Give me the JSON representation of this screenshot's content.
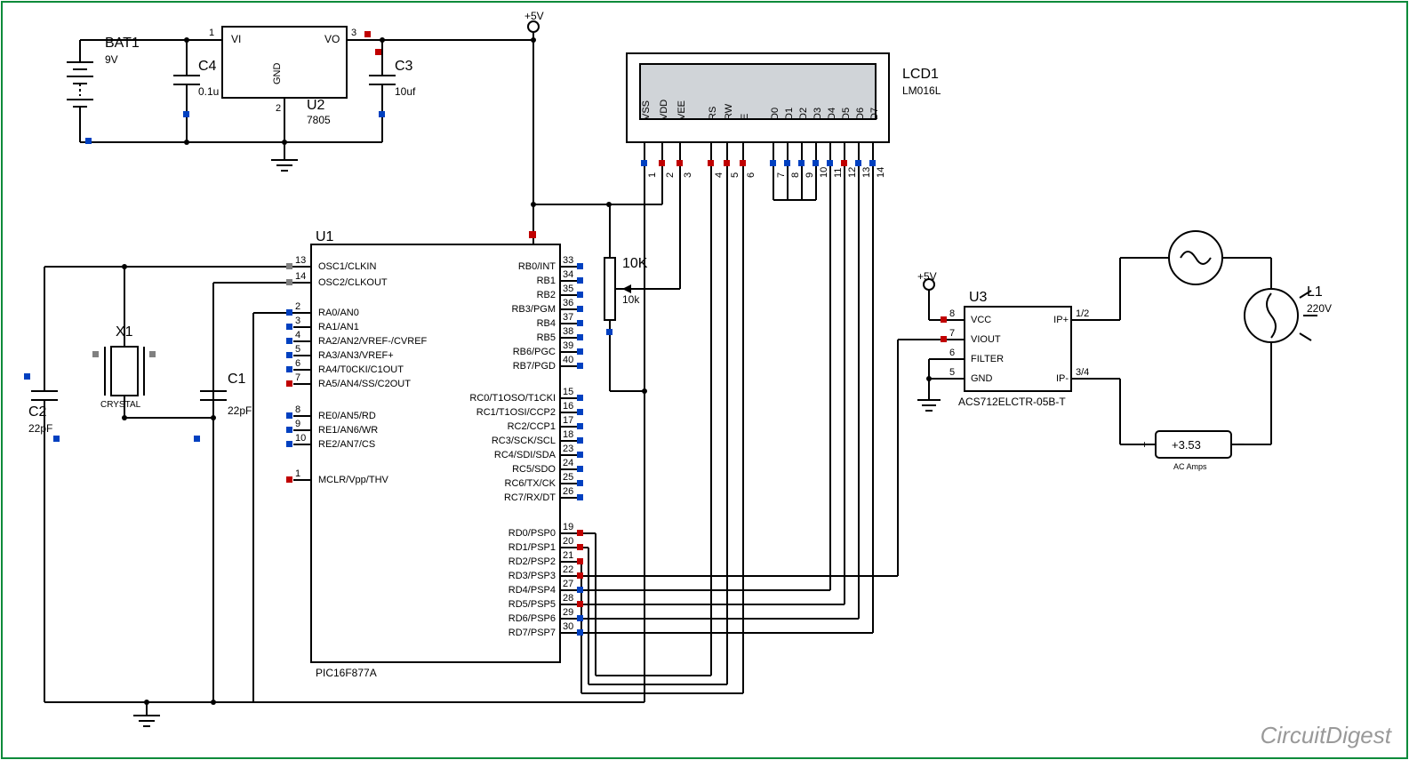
{
  "components": {
    "bat1": {
      "name": "BAT1",
      "value": "9V"
    },
    "c4": {
      "name": "C4",
      "value": "0.1u"
    },
    "u2": {
      "name": "U2",
      "value": "7805",
      "pins": {
        "vi": "VI",
        "vo": "VO",
        "gnd": "GND",
        "p1": "1",
        "p2": "2",
        "p3": "3"
      }
    },
    "c3": {
      "name": "C3",
      "value": "10uf"
    },
    "c2": {
      "name": "C2",
      "value": "22pF"
    },
    "c1": {
      "name": "C1",
      "value": "22pF"
    },
    "x1": {
      "name": "X1",
      "value": "CRYSTAL"
    },
    "u1": {
      "name": "U1",
      "value": "PIC16F877A"
    },
    "pot": {
      "name": "10K",
      "value": "10k"
    },
    "lcd1": {
      "name": "LCD1",
      "value": "LM016L"
    },
    "u3": {
      "name": "U3",
      "value": "ACS712ELCTR-05B-T"
    },
    "l1": {
      "name": "L1",
      "value": "220V"
    },
    "ammeter": {
      "reading": "+3.53",
      "unit": "AC Amps"
    }
  },
  "rails": {
    "five_v": "+5V"
  },
  "u1_pins_left": [
    {
      "num": "13",
      "name": "OSC1/CLKIN"
    },
    {
      "num": "14",
      "name": "OSC2/CLKOUT"
    },
    {
      "num": "2",
      "name": "RA0/AN0"
    },
    {
      "num": "3",
      "name": "RA1/AN1"
    },
    {
      "num": "4",
      "name": "RA2/AN2/VREF-/CVREF"
    },
    {
      "num": "5",
      "name": "RA3/AN3/VREF+"
    },
    {
      "num": "6",
      "name": "RA4/T0CKI/C1OUT"
    },
    {
      "num": "7",
      "name": "RA5/AN4/SS/C2OUT"
    },
    {
      "num": "8",
      "name": "RE0/AN5/RD"
    },
    {
      "num": "9",
      "name": "RE1/AN6/WR"
    },
    {
      "num": "10",
      "name": "RE2/AN7/CS"
    },
    {
      "num": "1",
      "name": "MCLR/Vpp/THV"
    }
  ],
  "u1_pins_right": [
    {
      "num": "33",
      "name": "RB0/INT"
    },
    {
      "num": "34",
      "name": "RB1"
    },
    {
      "num": "35",
      "name": "RB2"
    },
    {
      "num": "36",
      "name": "RB3/PGM"
    },
    {
      "num": "37",
      "name": "RB4"
    },
    {
      "num": "38",
      "name": "RB5"
    },
    {
      "num": "39",
      "name": "RB6/PGC"
    },
    {
      "num": "40",
      "name": "RB7/PGD"
    },
    {
      "num": "15",
      "name": "RC0/T1OSO/T1CKI"
    },
    {
      "num": "16",
      "name": "RC1/T1OSI/CCP2"
    },
    {
      "num": "17",
      "name": "RC2/CCP1"
    },
    {
      "num": "18",
      "name": "RC3/SCK/SCL"
    },
    {
      "num": "23",
      "name": "RC4/SDI/SDA"
    },
    {
      "num": "24",
      "name": "RC5/SDO"
    },
    {
      "num": "25",
      "name": "RC6/TX/CK"
    },
    {
      "num": "26",
      "name": "RC7/RX/DT"
    },
    {
      "num": "19",
      "name": "RD0/PSP0"
    },
    {
      "num": "20",
      "name": "RD1/PSP1"
    },
    {
      "num": "21",
      "name": "RD2/PSP2"
    },
    {
      "num": "22",
      "name": "RD3/PSP3"
    },
    {
      "num": "27",
      "name": "RD4/PSP4"
    },
    {
      "num": "28",
      "name": "RD5/PSP5"
    },
    {
      "num": "29",
      "name": "RD6/PSP6"
    },
    {
      "num": "30",
      "name": "RD7/PSP7"
    }
  ],
  "lcd_pins": [
    {
      "num": "1",
      "name": "VSS"
    },
    {
      "num": "2",
      "name": "VDD"
    },
    {
      "num": "3",
      "name": "VEE"
    },
    {
      "num": "4",
      "name": "RS"
    },
    {
      "num": "5",
      "name": "RW"
    },
    {
      "num": "6",
      "name": "E"
    },
    {
      "num": "7",
      "name": "D0"
    },
    {
      "num": "8",
      "name": "D1"
    },
    {
      "num": "9",
      "name": "D2"
    },
    {
      "num": "10",
      "name": "D3"
    },
    {
      "num": "11",
      "name": "D4"
    },
    {
      "num": "12",
      "name": "D5"
    },
    {
      "num": "13",
      "name": "D6"
    },
    {
      "num": "14",
      "name": "D7"
    }
  ],
  "u3_pins_left": [
    {
      "num": "8",
      "name": "VCC"
    },
    {
      "num": "7",
      "name": "VIOUT"
    },
    {
      "num": "6",
      "name": "FILTER"
    },
    {
      "num": "5",
      "name": "GND"
    }
  ],
  "u3_pins_right": [
    {
      "num": "1/2",
      "name": "IP+"
    },
    {
      "num": "3/4",
      "name": "IP-"
    }
  ],
  "watermark": "CircuitDigest",
  "plus": "+",
  "minus": "−"
}
